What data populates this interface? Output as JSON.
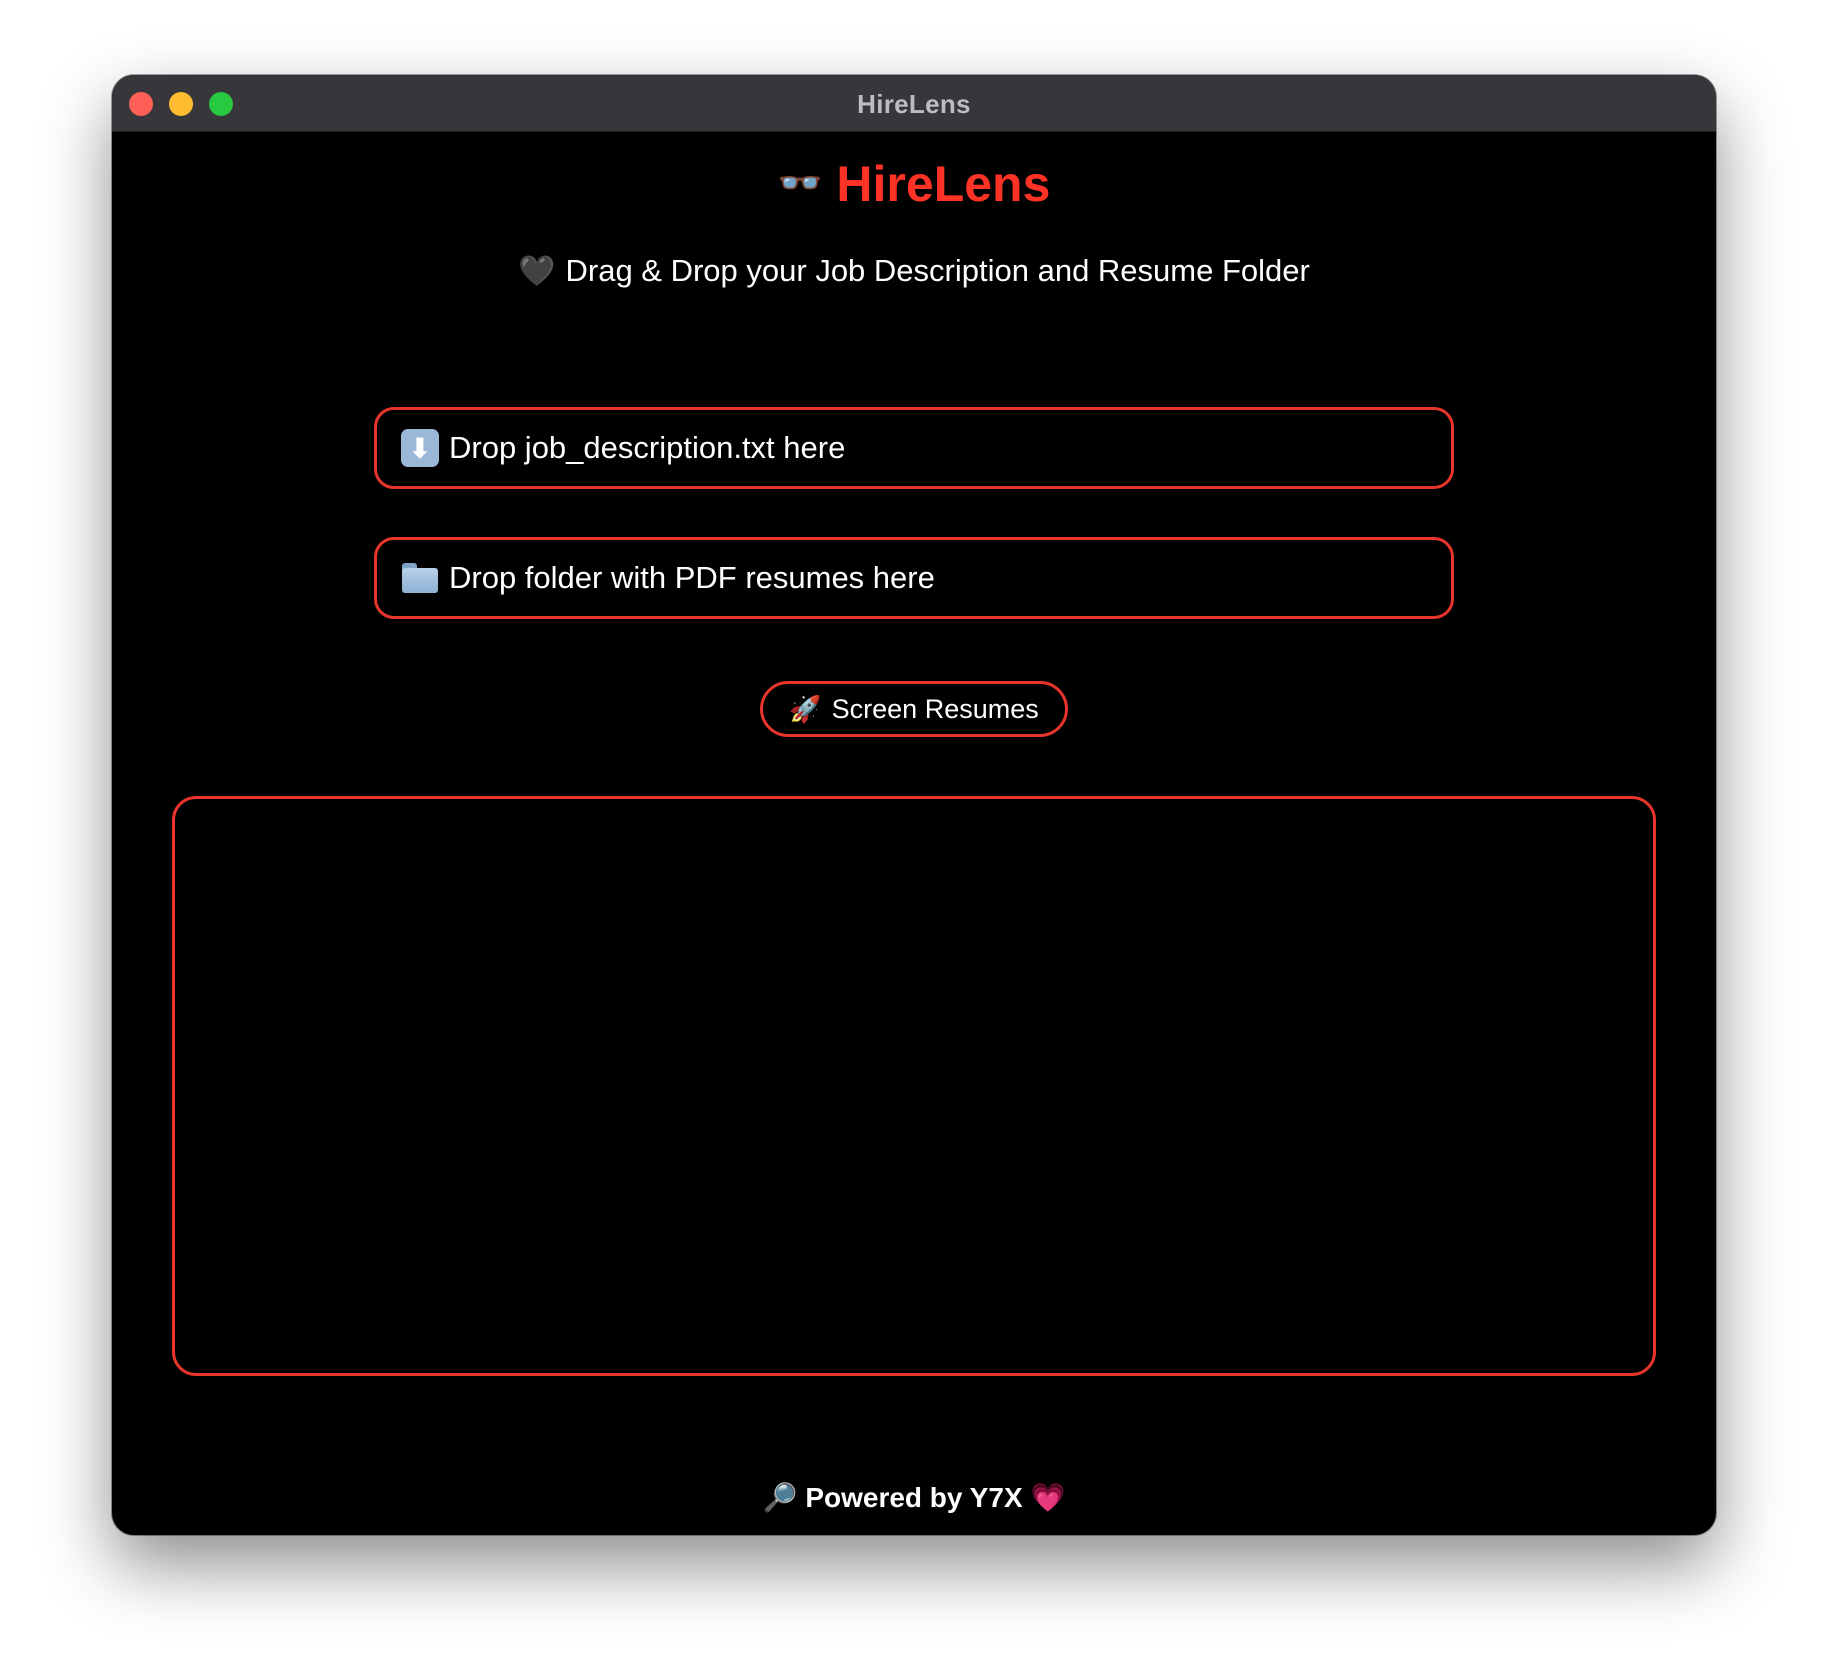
{
  "window": {
    "title": "HireLens"
  },
  "header": {
    "glasses_glyph": "👓",
    "title": "HireLens"
  },
  "subtitle": {
    "heart_glyph": "🖤",
    "text": "Drag & Drop your Job Description and Resume Folder"
  },
  "drop_zones": {
    "job": {
      "icon": "down-arrow-icon",
      "arrow_glyph": "⬇",
      "label": "Drop job_description.txt here"
    },
    "folder": {
      "icon": "folder-icon",
      "label": "Drop folder with PDF resumes here"
    }
  },
  "actions": {
    "rocket_glyph": "🚀",
    "screen_label": "Screen Resumes"
  },
  "footer": {
    "magnifier_glyph": "🔎",
    "text": "Powered by Y7X",
    "heart_glyph": "💗"
  },
  "colors": {
    "accent": "#e8352b",
    "title_red": "#ff3226",
    "background": "#000000",
    "titlebar": "#36363b"
  }
}
